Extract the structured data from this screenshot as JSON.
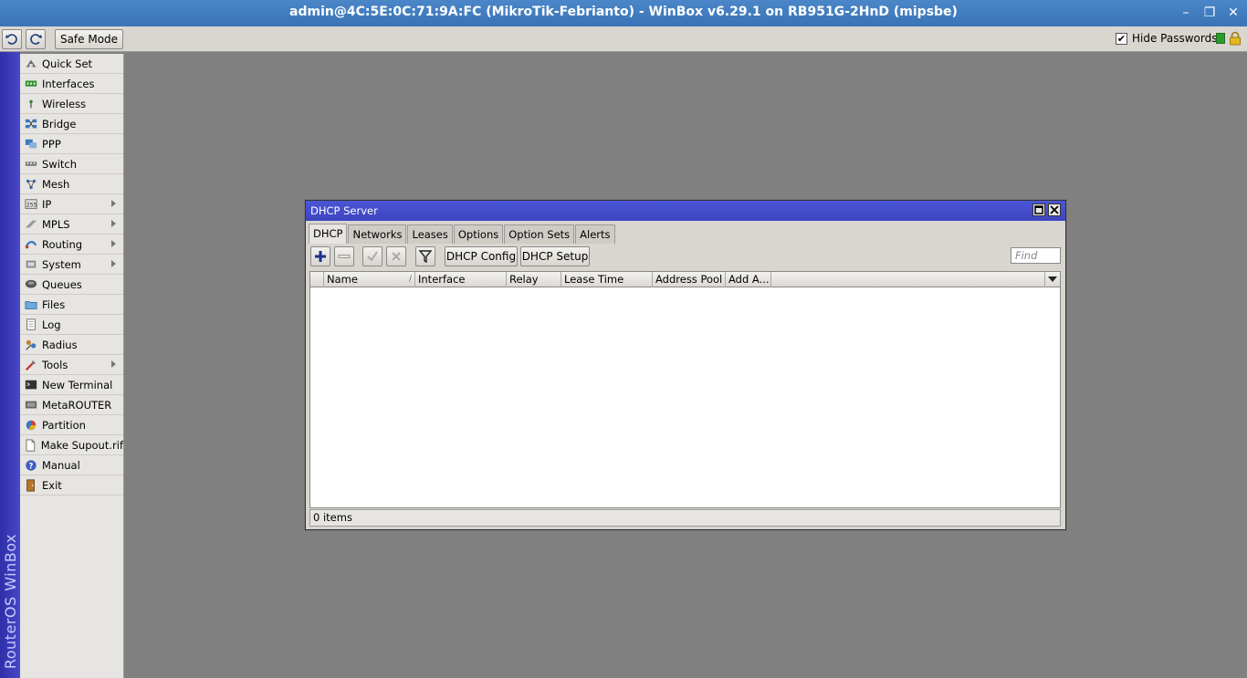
{
  "app": {
    "title": "admin@4C:5E:0C:71:9A:FC (MikroTik-Febrianto) - WinBox v6.29.1 on RB951G-2HnD (mipsbe)",
    "vertical_brand": "RouterOS WinBox"
  },
  "window_controls": {
    "minimize": "–",
    "restore": "❐",
    "close": "✕"
  },
  "toolbar": {
    "undo_icon": "undo-icon",
    "redo_icon": "redo-icon",
    "safe_mode_label": "Safe Mode",
    "hide_passwords_label": "Hide Passwords",
    "hide_passwords_checked": "✔"
  },
  "sidebar": {
    "items": [
      {
        "label": "Quick Set",
        "icon": "quick-set-icon",
        "submenu": false
      },
      {
        "label": "Interfaces",
        "icon": "interfaces-icon",
        "submenu": false
      },
      {
        "label": "Wireless",
        "icon": "wireless-icon",
        "submenu": false
      },
      {
        "label": "Bridge",
        "icon": "bridge-icon",
        "submenu": false
      },
      {
        "label": "PPP",
        "icon": "ppp-icon",
        "submenu": false
      },
      {
        "label": "Switch",
        "icon": "switch-icon",
        "submenu": false
      },
      {
        "label": "Mesh",
        "icon": "mesh-icon",
        "submenu": false
      },
      {
        "label": "IP",
        "icon": "ip-icon",
        "submenu": true
      },
      {
        "label": "MPLS",
        "icon": "mpls-icon",
        "submenu": true
      },
      {
        "label": "Routing",
        "icon": "routing-icon",
        "submenu": true
      },
      {
        "label": "System",
        "icon": "system-icon",
        "submenu": true
      },
      {
        "label": "Queues",
        "icon": "queues-icon",
        "submenu": false
      },
      {
        "label": "Files",
        "icon": "files-icon",
        "submenu": false
      },
      {
        "label": "Log",
        "icon": "log-icon",
        "submenu": false
      },
      {
        "label": "Radius",
        "icon": "radius-icon",
        "submenu": false
      },
      {
        "label": "Tools",
        "icon": "tools-icon",
        "submenu": true
      },
      {
        "label": "New Terminal",
        "icon": "terminal-icon",
        "submenu": false
      },
      {
        "label": "MetaROUTER",
        "icon": "metarouter-icon",
        "submenu": false
      },
      {
        "label": "Partition",
        "icon": "partition-icon",
        "submenu": false
      },
      {
        "label": "Make Supout.rif",
        "icon": "supout-icon",
        "submenu": false
      },
      {
        "label": "Manual",
        "icon": "manual-icon",
        "submenu": false
      },
      {
        "label": "Exit",
        "icon": "exit-icon",
        "submenu": false
      }
    ]
  },
  "dhcp_window": {
    "title": "DHCP Server",
    "tabs": [
      "DHCP",
      "Networks",
      "Leases",
      "Options",
      "Option Sets",
      "Alerts"
    ],
    "active_tab": "DHCP",
    "buttons": {
      "dhcp_config": "DHCP Config",
      "dhcp_setup": "DHCP Setup"
    },
    "find_placeholder": "Find",
    "columns": [
      "Name",
      "Interface",
      "Relay",
      "Lease Time",
      "Address Pool",
      "Add A..."
    ],
    "rows": [],
    "status": "0 items"
  }
}
